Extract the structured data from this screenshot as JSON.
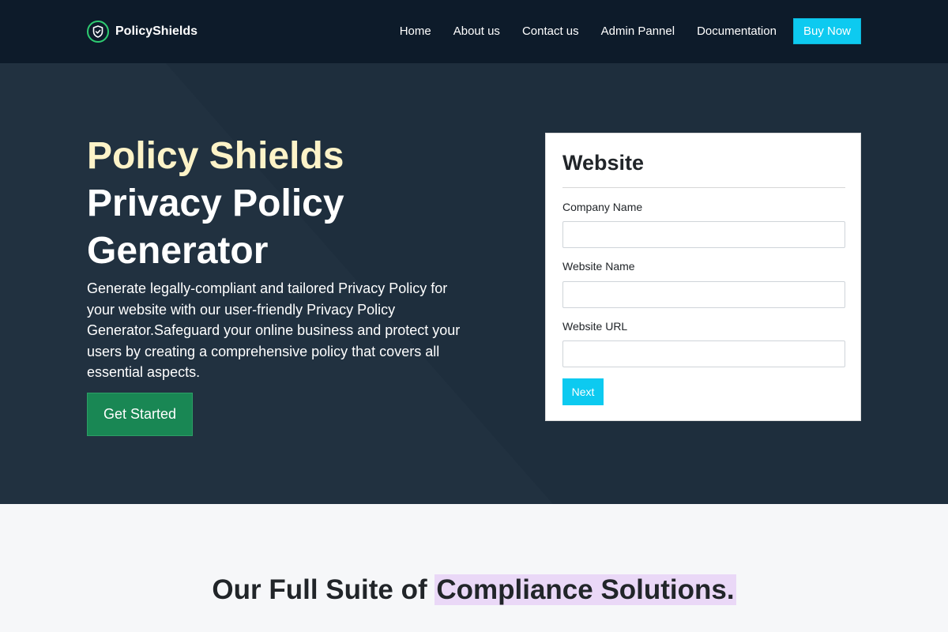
{
  "nav": {
    "brand": "PolicyShields",
    "links": [
      "Home",
      "About us",
      "Contact us",
      "Admin Pannel",
      "Documentation"
    ],
    "buy_label": "Buy Now"
  },
  "hero": {
    "title_accent": "Policy Shields",
    "title_rest": "Privacy Policy Generator",
    "description": "Generate legally-compliant and tailored Privacy Policy for your website with our user-friendly Privacy Policy Generator.Safeguard your online business and protect your users by creating a comprehensive policy that covers all essential aspects.",
    "cta_label": "Get Started"
  },
  "form": {
    "title": "Website",
    "fields": [
      {
        "label": "Company Name",
        "value": ""
      },
      {
        "label": "Website Name",
        "value": ""
      },
      {
        "label": "Website URL",
        "value": ""
      }
    ],
    "next_label": "Next"
  },
  "suite": {
    "title_prefix": "Our Full Suite of",
    "title_highlight": "Compliance Solutions."
  },
  "colors": {
    "nav_bg": "#0d1b2a",
    "hero_bg": "#1e2e3d",
    "accent_cyan": "#0dcaf0",
    "cta_green": "#198754",
    "title_cream": "#fdf3c8",
    "highlight_lilac": "#ead8f7"
  },
  "icons": {
    "brand": "shield-icon"
  }
}
